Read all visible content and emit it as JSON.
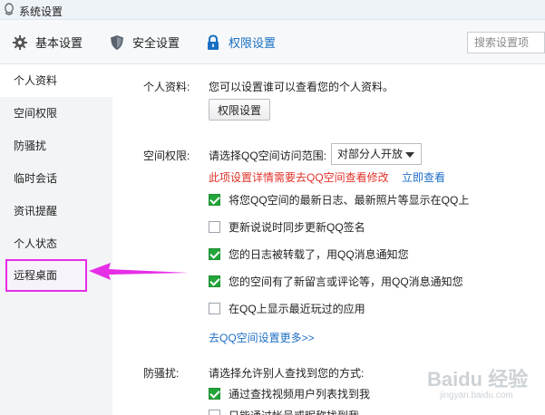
{
  "window": {
    "title": "系统设置"
  },
  "toolbar": {
    "tabs": [
      {
        "label": "基本设置",
        "icon": "gear-icon"
      },
      {
        "label": "安全设置",
        "icon": "shield-icon"
      },
      {
        "label": "权限设置",
        "icon": "lock-icon",
        "active": true
      }
    ],
    "search_placeholder": "搜索设置项"
  },
  "sidebar": {
    "items": [
      {
        "label": "个人资料",
        "active": true
      },
      {
        "label": "空间权限"
      },
      {
        "label": "防骚扰"
      },
      {
        "label": "临时会话"
      },
      {
        "label": "资讯提醒"
      },
      {
        "label": "个人状态"
      },
      {
        "label": "远程桌面",
        "highlighted": true
      }
    ]
  },
  "profile": {
    "label": "个人资料:",
    "desc": "您可以设置谁可以查看您的个人资料。",
    "button": "权限设置"
  },
  "space": {
    "label": "空间权限:",
    "scope_label": "请选择QQ空间访问范围:",
    "scope_value": "对部分人开放",
    "warning": "此项设置详情需要去QQ空间查看修改",
    "view_link": "立即查看",
    "options": [
      {
        "label": "将您QQ空间的最新日志、最新照片等显示在QQ上",
        "checked": true
      },
      {
        "label": "更新说说时同步更新QQ签名",
        "checked": false
      },
      {
        "label": "您的日志被转载了，用QQ消息通知您",
        "checked": true
      },
      {
        "label": "您的空间有了新留言或评论等，用QQ消息通知您",
        "checked": true
      },
      {
        "label": "在QQ上显示最近玩过的应用",
        "checked": false
      }
    ],
    "more_link": "去QQ空间设置更多>>"
  },
  "harass": {
    "label": "防骚扰:",
    "desc": "请选择允许别人查找到您的方式:",
    "options": [
      {
        "label": "通过查找视频用户列表找到我",
        "checked": true
      },
      {
        "label": "只能通过帐号或昵称找到我",
        "checked": false
      }
    ]
  },
  "watermark": {
    "brand": "Baidu 经验",
    "url": "jingyan.baidu.com"
  },
  "colors": {
    "accent": "#1a6fc2",
    "warning": "#e0322a",
    "checkbox": "#22a53a",
    "highlight": "#e62ee6"
  }
}
